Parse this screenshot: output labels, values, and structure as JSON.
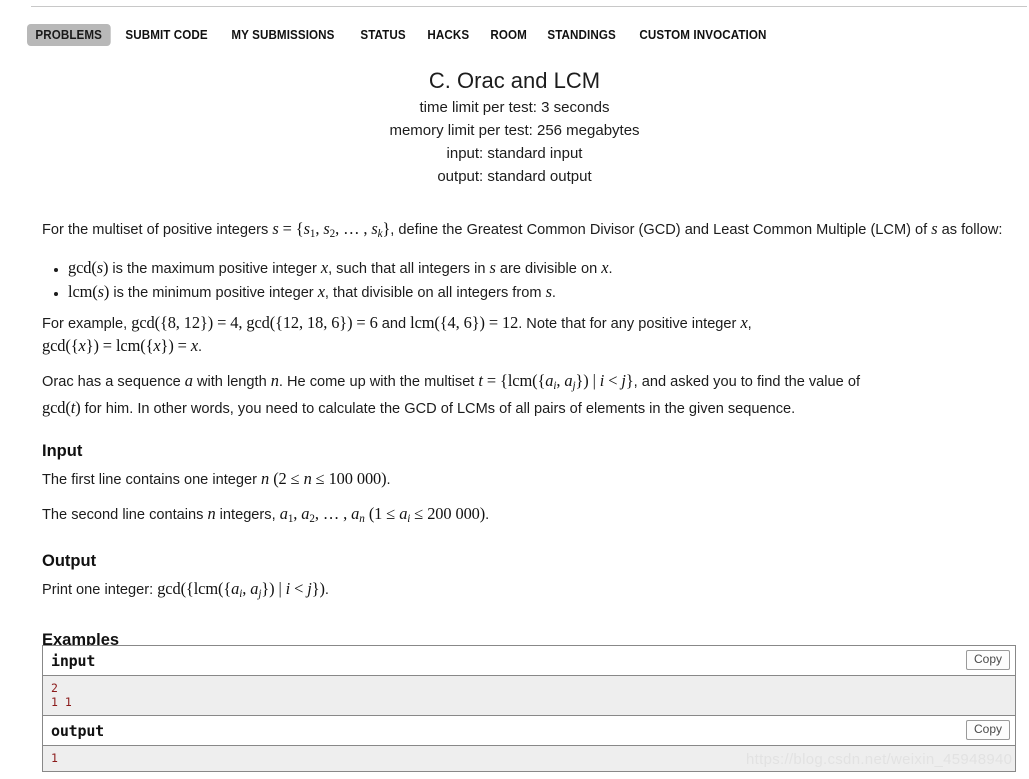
{
  "nav": {
    "items": [
      {
        "label": "PROBLEMS",
        "active": true
      },
      {
        "label": "SUBMIT CODE",
        "active": false
      },
      {
        "label": "MY SUBMISSIONS",
        "active": false
      },
      {
        "label": "STATUS",
        "active": false
      },
      {
        "label": "HACKS",
        "active": false
      },
      {
        "label": "ROOM",
        "active": false
      },
      {
        "label": "STANDINGS",
        "active": false
      },
      {
        "label": "CUSTOM INVOCATION",
        "active": false
      }
    ]
  },
  "problem": {
    "title": "C. Orac and LCM",
    "time_limit": "time limit per test: 3 seconds",
    "memory_limit": "memory limit per test: 256 megabytes",
    "input_spec": "input: standard input",
    "output_spec": "output: standard output"
  },
  "statement": {
    "intro_before_math": "For the multiset of positive integers ",
    "intro_math_s": "s",
    "intro_eq": " = ",
    "intro_set": "{s₁, s₂, … , s_k}",
    "intro_after": ", define the Greatest Common Divisor (GCD) and Least Common Multiple (LCM) of s as follow:",
    "bullet1": "gcd(s) is the maximum positive integer x, such that all integers in s are divisible on x.",
    "bullet2": "lcm(s) is the minimum positive integer x, that divisible on all integers from s.",
    "example_line": "For example, gcd({8, 12}) = 4, gcd({12, 18, 6}) = 6 and lcm({4, 6}) = 12. Note that for any positive integer x, gcd({x}) = lcm({x}) = x.",
    "orac_line": "Orac has a sequence a with length n. He come up with the multiset t = {lcm({a_i, a_j}) | i < j}, and asked you to find the value of gcd(t) for him. In other words, you need to calculate the GCD of LCMs of all pairs of elements in the given sequence."
  },
  "sections": {
    "input_title": "Input",
    "input_line1": "The first line contains one integer n (2 ≤ n ≤ 100 000).",
    "input_line2": "The second line contains n integers, a₁, a₂, … , a_n (1 ≤ a_i ≤ 200 000).",
    "output_title": "Output",
    "output_line1": "Print one integer: gcd({lcm({a_i, a_j}) | i < j}).",
    "examples_title": "Examples"
  },
  "samples": [
    {
      "label": "input",
      "copy_label": "Copy",
      "content": "2\n1 1"
    },
    {
      "label": "output",
      "copy_label": "Copy",
      "content": "1"
    }
  ],
  "watermark": "https://blog.csdn.net/weixin_45948940",
  "colors": {
    "active_tab_bg": "#b8b8b8",
    "sample_body_bg": "#eeeeee",
    "sample_text": "#8b1a1a",
    "border": "#888888",
    "watermark": "#e2e2e2"
  }
}
